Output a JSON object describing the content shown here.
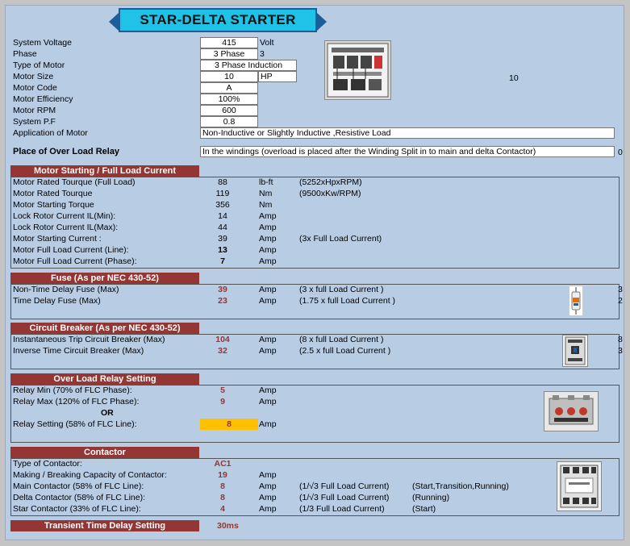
{
  "title": "STAR-DELTA STARTER",
  "inputs": [
    {
      "label": "System Voltage",
      "value": "415",
      "unit": "Volt"
    },
    {
      "label": "Phase",
      "value": "3 Phase",
      "unit": "3"
    },
    {
      "label": "Type of Motor",
      "value": "3 Phase Induction"
    },
    {
      "label": "Motor Size",
      "value": "10",
      "unit": "HP"
    },
    {
      "label": "Motor Code",
      "value": "A"
    },
    {
      "label": "Motor Efficiency",
      "value": "100%"
    },
    {
      "label": "Motor RPM",
      "value": "600"
    },
    {
      "label": "System P.F",
      "value": "0.8"
    },
    {
      "label": "Application of Motor",
      "value": "Non-Inductive or Slightly Inductive ,Resistive Load"
    },
    {
      "label": "Place of Over Load Relay",
      "value": "In the windings (overload is placed after the Winding Split in to main and delta Contactor)"
    }
  ],
  "side_values": {
    "size_extra": "10",
    "overload_extra": "0",
    "fuse1_extra": "3",
    "fuse2_extra": "2",
    "cb1_extra": "8",
    "cb2_extra": "3"
  },
  "sections": {
    "motor": {
      "header": "Motor Starting / Full Load Current",
      "rows": [
        {
          "label": "Motor Rated Tourque (Full Load)",
          "value": "88",
          "unit": "lb-ft",
          "note": "(5252xHpxRPM)"
        },
        {
          "label": "Motor Rated Tourque",
          "value": "119",
          "unit": "Nm",
          "note": "(9500xKw/RPM)"
        },
        {
          "label": "Motor Starting Torque",
          "value": "356",
          "unit": "Nm",
          "note": ""
        },
        {
          "label": "Lock Rotor Current IL(Min):",
          "value": "14",
          "unit": "Amp",
          "note": ""
        },
        {
          "label": "Lock Rotor Current IL(Max):",
          "value": "44",
          "unit": "Amp",
          "note": ""
        },
        {
          "label": "Motor Starting Current :",
          "value": "39",
          "unit": "Amp",
          "note": "(3x Full Load Current)"
        },
        {
          "label": "Motor Full Load Current (Line):",
          "value": "13",
          "unit": "Amp",
          "note": ""
        },
        {
          "label": "Motor Full Load Current (Phase):",
          "value": "7",
          "unit": "Amp",
          "note": ""
        }
      ]
    },
    "fuse": {
      "header": "Fuse (As per NEC 430-52)",
      "rows": [
        {
          "label": "Non-Time Delay Fuse (Max)",
          "value": "39",
          "unit": "Amp",
          "note": "(3 x full Load Current )"
        },
        {
          "label": "Time Delay Fuse (Max)",
          "value": "23",
          "unit": "Amp",
          "note": "(1.75 x full Load Current )"
        }
      ]
    },
    "breaker": {
      "header": "Circuit Breaker (As per NEC 430-52)",
      "rows": [
        {
          "label": "Instantaneous Trip Circuit Breaker (Max)",
          "value": "104",
          "unit": "Amp",
          "note": "(8 x full Load Current )"
        },
        {
          "label": "Inverse Time Circuit Breaker (Max)",
          "value": "32",
          "unit": "Amp",
          "note": "(2.5 x full Load Current )"
        }
      ]
    },
    "relay": {
      "header": "Over Load Relay  Setting",
      "rows": [
        {
          "label": "Relay Min (70% of FLC Phase):",
          "value": "5",
          "unit": "Amp"
        },
        {
          "label": "Relay Max (120% of FLC Phase):",
          "value": "9",
          "unit": "Amp"
        },
        {
          "label": "Relay Setting (58% of FLC Line):",
          "value": "8",
          "unit": "Amp"
        }
      ],
      "or_label": "OR"
    },
    "contactor": {
      "header": "Contactor",
      "rows": [
        {
          "label": "Type of Contactor:",
          "value": "AC1",
          "unit": "",
          "note": "",
          "note2": ""
        },
        {
          "label": "Making / Breaking Capacity of Contactor:",
          "value": "19",
          "unit": "Amp",
          "note": "",
          "note2": ""
        },
        {
          "label": "Main Contactor (58% of FLC Line):",
          "value": "8",
          "unit": "Amp",
          "note": "(1/√3 Full Load Current)",
          "note2": "(Start,Transition,Running)"
        },
        {
          "label": "Delta Contactor (58% of FLC Line):",
          "value": "8",
          "unit": "Amp",
          "note": "(1/√3 Full Load Current)",
          "note2": "(Running)"
        },
        {
          "label": "Star Contactor  (33% of FLC Line):",
          "value": "4",
          "unit": "Amp",
          "note": "(1/3 Full Load Current)",
          "note2": "(Start)"
        }
      ]
    },
    "transient": {
      "header": "Transient Time Delay Setting",
      "value": "30ms"
    }
  },
  "colors": {
    "background": "#b8cce4",
    "band": "#943634",
    "title_fill": "#1fc3e8",
    "highlight": "#ffc000"
  }
}
